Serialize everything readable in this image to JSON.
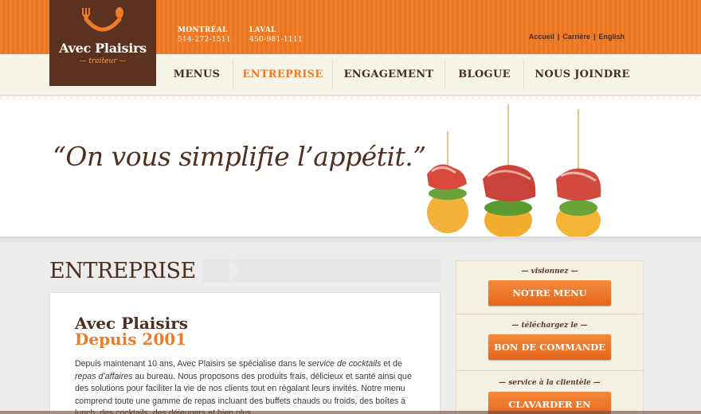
{
  "logo": {
    "brand": "Avec Plaisirs",
    "sub": "— traiteur —"
  },
  "contacts": [
    {
      "city": "MONTRÉAL",
      "phone": "514-272-1511"
    },
    {
      "city": "LAVAL",
      "phone": "450-981-1111"
    }
  ],
  "toplinks": [
    "Accueil",
    "Carrière",
    "English"
  ],
  "nav": [
    "MENUS",
    "ENTREPRISE",
    "ENGAGEMENT",
    "BLOGUE",
    "NOUS JOINDRE"
  ],
  "nav_active": "ENTREPRISE",
  "hero": {
    "tagline": "“On vous simplifie l’appétit.”"
  },
  "section": {
    "title": "ENTREPRISE"
  },
  "card": {
    "heading": "Avec Plaisirs",
    "subheading": "Depuis 2001",
    "body_1": "Depuis maintenant 10 ans, Avec Plaisirs se spécialise dans le ",
    "em_1": "service de cocktails",
    "body_2": " et de ",
    "em_2": "repas d’affaires",
    "body_3": " au bureau. Nous proposons des produits frais, délicieux et santé ainsi que des solutions pour faciliter la vie de nos clients tout en régalant leurs invités. Notre menu comprend toute une gamme de repas incluant des buffets chauds ou froids, des boîtes à lunch, des cocktails, des déjeuners et bien plus."
  },
  "sidebar": [
    {
      "label": "— visionnez —",
      "button": "NOTRE MENU"
    },
    {
      "label": "— téléchargez le —",
      "button": "BON DE COMMANDE"
    },
    {
      "label": "— service à la clientèle —",
      "button": "CLAVARDER EN DIRECT"
    }
  ],
  "colors": {
    "orange": "#ee7b2a",
    "brown": "#5b321f",
    "cream": "#f6f3e7"
  }
}
